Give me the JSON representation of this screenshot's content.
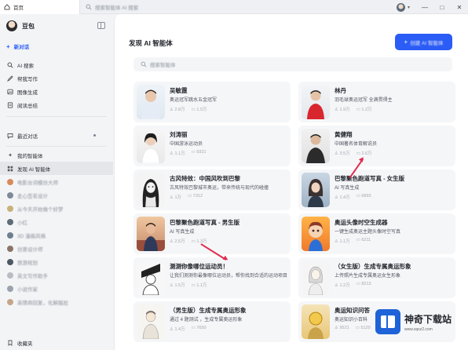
{
  "topbar": {
    "tab_label": "首页",
    "search_placeholder": "搜索智能体 AI 搜索",
    "window_buttons": [
      "—",
      "□",
      "✕"
    ]
  },
  "sidebar": {
    "brand_name": "豆包",
    "new_chat": "新对话",
    "tools": [
      {
        "label": "AI 搜索",
        "icon": "search-icon"
      },
      {
        "label": "帮我写作",
        "icon": "pen-icon"
      },
      {
        "label": "图像生成",
        "icon": "image-icon"
      },
      {
        "label": "阅读总结",
        "icon": "doc-icon"
      }
    ],
    "recent_label": "最近对话",
    "my_agents": "我的智能体",
    "discover_agents": "发现 AI 智能体",
    "bots": [
      {
        "label": "电影台词模仿大师",
        "color": "#d98a5a"
      },
      {
        "label": "走心签名设计",
        "color": "#7e8a98"
      },
      {
        "label": "从今天开始做个好梦",
        "color": "#c9b27a"
      },
      {
        "label": "小红",
        "color": "#5e6b78"
      },
      {
        "label": "3D 漫画风格",
        "color": "#6e7f90"
      },
      {
        "label": "创意设计师",
        "color": "#8a7468"
      },
      {
        "label": "旅游规划",
        "color": "#4d5966"
      },
      {
        "label": "英文写作助手",
        "color": "#b8bcc3"
      },
      {
        "label": "小说作家",
        "color": "#9aa2ad"
      },
      {
        "label": "高情商回复，化解尴尬",
        "color": "#c5a68a"
      }
    ],
    "favorites": "收藏夹"
  },
  "main": {
    "title": "发现 AI 智能体",
    "create_label": "创建 AI 智能体",
    "search_placeholder": "搜索智能体",
    "cards": [
      {
        "name": "吴敏霞",
        "desc": "奥运冠军跳水五金冠军",
        "stats": [
          "2.8万",
          "1.5万"
        ],
        "thumb": "person-blue"
      },
      {
        "name": "林丹",
        "desc": "羽毛球奥运冠军 全满贯得主",
        "stats": [
          "1.9万",
          "1.2万"
        ],
        "thumb": "person-red"
      },
      {
        "name": "刘涛丽",
        "desc": "中国游泳运动员",
        "stats": [
          "1.1万",
          "9321"
        ],
        "thumb": "person-white"
      },
      {
        "name": "黄健翔",
        "desc": "中国著名体育解说员",
        "stats": [
          "3.5万",
          "2.6万"
        ],
        "thumb": "person-dark"
      },
      {
        "name": "古风特效：中国风吹到巴黎",
        "desc": "古风特效巴黎城市奥运，带来传统与现代的碰撞",
        "stats": [
          "1万",
          "7312"
        ],
        "thumb": "art-bw"
      },
      {
        "name": "巴黎聚色跑道写真 - 女生版",
        "desc": "AI 写真生成",
        "stats": [
          "1.4万",
          "6893"
        ],
        "thumb": "art-girl"
      },
      {
        "name": "巴黎聚色跑道写真 - 男生版",
        "desc": "AI 写真生成",
        "stats": [
          "2.5万",
          "1.3万"
        ],
        "thumb": "art-boy"
      },
      {
        "name": "奥运头像时空生成器",
        "desc": "一键生成奥运主题头像时空写真",
        "stats": [
          "1.1万",
          "6211"
        ],
        "thumb": "art-orange"
      },
      {
        "name": "测测你像哪位运动员！",
        "desc": "让我们测测你最像哪位运动员，帮你找到合适的运动项目",
        "stats": [
          "1.5万",
          "1.1万"
        ],
        "thumb": "art-comic"
      },
      {
        "name": "（女生版）生成专属奥运形象",
        "desc": "上传照片生成专属奥运女生形象",
        "stats": [
          "1.2万",
          "8213"
        ],
        "thumb": "art-sketch"
      },
      {
        "name": "（男生版）生成专属奥运形象",
        "desc": "通过 4 题测试 ，生成专属奥运形象",
        "stats": [
          "1.4万",
          "7650"
        ],
        "thumb": "art-sketch2"
      },
      {
        "name": "奥运知识问答",
        "desc": "奥运知识小百科",
        "stats": [
          "9521",
          "5120"
        ],
        "thumb": "art-gold"
      }
    ]
  },
  "watermark": {
    "title": "神奇下载站",
    "url": "www.sqxz2.com"
  },
  "colors": {
    "accent": "#2b5cf5",
    "annotation_arrow": "#e02b4e"
  }
}
